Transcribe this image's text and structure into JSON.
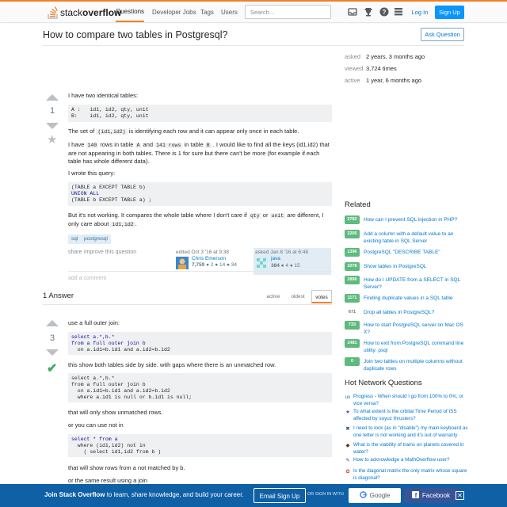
{
  "header": {
    "logo_prefix": "stack",
    "logo_bold": "overflow",
    "nav": [
      "Questions",
      "Developer Jobs",
      "Tags",
      "Users"
    ],
    "search_placeholder": "Search…",
    "login": "Log In",
    "signup": "Sign Up"
  },
  "question": {
    "title": "How to compare two tables in Postgresql?",
    "ask_button": "Ask Question",
    "meta": [
      {
        "label": "asked",
        "value": "2 years, 3 months ago"
      },
      {
        "label": "viewed",
        "value": "3,724 times"
      },
      {
        "label": "active",
        "value": "1 year, 6 months ago"
      }
    ],
    "votes": "1",
    "p1": "I have two identical tables:",
    "code1": "A :   id1, id2, qty, unit\nB:    id1, id2, qty, unit",
    "p2_a": "The set of",
    "p2_code": "(id1,id2)",
    "p2_b": "is identifying each row and it can appear only once in each table.",
    "p3_a": "I have",
    "p3_c1": "140",
    "p3_b": "rows in table",
    "p3_c2": "A",
    "p3_c": "and",
    "p3_c3": "141 rows",
    "p3_d": "in table",
    "p3_c4": "B",
    "p3_e": ". I would like to find all the keys (id1,id2) that are not appearing in both tables. There is 1 for sure but there can't be more (for example if each table has whole different data).",
    "p4": "I wrote this query:",
    "code2_l1": "(TABLE a EXCEPT TABLE b)",
    "code2_l2": "UNION ALL",
    "code2_l3": "(TABLE b EXCEPT TABLE a) ;",
    "p5_a": "But it's not working. It compares the whole table where I don't care if",
    "p5_c1": "qty",
    "p5_b": "or",
    "p5_c2": "unit",
    "p5_c": "are different, I only care about",
    "p5_c3": "id1,id2",
    "p5_d": ".",
    "tags": [
      "sql",
      "postgresql"
    ],
    "menu": [
      "share",
      "improve this question"
    ],
    "editor": {
      "when": "edited Oct 3 '16 at 9:38",
      "name": "Chris Emerson",
      "rep": "7,759",
      "badges": "● 2  ● 14  ● 34"
    },
    "asker": {
      "when": "asked Jan 8 '16 at 6:48",
      "name": "java",
      "rep": "384",
      "badges": "● 4  ● 15"
    },
    "add_comment": "add a comment"
  },
  "answers": {
    "heading": "1 Answer",
    "tabs": [
      "active",
      "oldest",
      "votes"
    ],
    "votes": "3",
    "a1": "use a full outer join:",
    "code1_l1": "select a.*,b.*",
    "code1_l2": "from a full outer join b",
    "code1_l3": "  on a.id1=b.id1 and a.id2=b.id2",
    "a2": "this show both tables side by side. with gaps where there is an unmatched row.",
    "code2_l1": "select a.*,b.*",
    "code2_l2": "from a full outer join b",
    "code2_l3": "  on a.id1=b.id1 and a.id2=b.id2",
    "code2_l4": "  where a.id1 is null or b.id1 is null;",
    "a3": "that will only show unmatched rows.",
    "a4": "or you can use not in",
    "code3_l1": "select * from a",
    "code3_l2": "  where (id1,id2) not in",
    "code3_l3": "    ( select id1,id2 from b )",
    "a5": "that will show rows from a not matched by b.",
    "a6": "or the same result using a join"
  },
  "related": {
    "heading": "Related",
    "items": [
      {
        "count": "2782",
        "text": "How can I prevent SQL injection in PHP?"
      },
      {
        "count": "2205",
        "text": "Add a column with a default value to an existing table in SQL Server"
      },
      {
        "count": "1396",
        "text": "PostgreSQL \"DESCRIBE TABLE\""
      },
      {
        "count": "1078",
        "text": "Show tables in PostgreSQL"
      },
      {
        "count": "2890",
        "text": "How do I UPDATE from a SELECT in SQL Server?"
      },
      {
        "count": "1171",
        "text": "Finding duplicate values in a SQL table"
      },
      {
        "count": "671",
        "text": "Drop all tables in PostgreSQL?"
      },
      {
        "count": "733",
        "text": "How to start PostgreSQL server on Mac OS X?"
      },
      {
        "count": "1481",
        "text": "How to exit from PostgreSQL command line utility: psql"
      },
      {
        "count": "0",
        "text": "Join two tables on multiple columns without duplicate rows"
      }
    ]
  },
  "hot": {
    "heading": "Hot Network Questions",
    "items": [
      {
        "icon": "ux",
        "color": "#2a6db4",
        "text": "Progress - When should I go from 100% to 0%, or vice versa?"
      },
      {
        "icon": "★",
        "color": "#3f5fa9",
        "text": "To what extent is the orbital Time Period of ISS affected by soyuz thrusters?"
      },
      {
        "icon": "✖",
        "color": "#2e4d6e",
        "text": "I need to lock (as in \"disable\") my main keyboard as one letter is not working and it's out of warranty"
      },
      {
        "icon": "◆",
        "color": "#5a3b20",
        "text": "What is the viability of trains on planets covered in water?"
      },
      {
        "icon": "✎",
        "color": "#1a5a99",
        "text": "How to acknowledge a MathOverflow user?"
      },
      {
        "icon": "✿",
        "color": "#c0392b",
        "text": "Is the diagonal matrix the only matrix whose square is diagonal?"
      }
    ]
  },
  "footer": {
    "bold": "Join Stack Overflow",
    "rest": " to learn, share knowledge, and build your career.",
    "email": "Email Sign Up",
    "or": "OR SIGN IN WITH",
    "google": "Google",
    "facebook": "Facebook",
    "close": "✕"
  }
}
